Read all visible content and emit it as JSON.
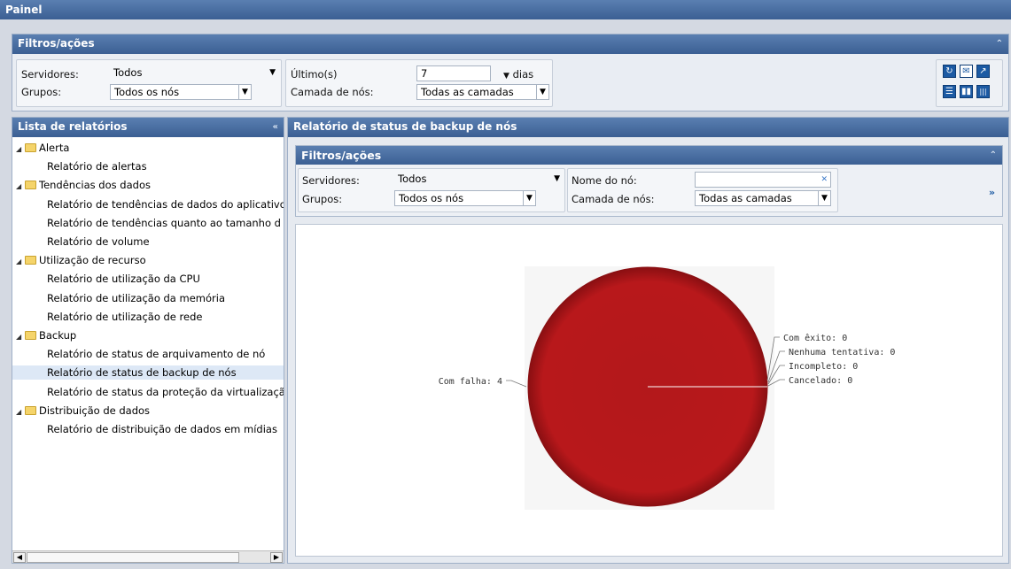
{
  "page": {
    "title": "Painel"
  },
  "top_filters": {
    "title": "Filtros/ações",
    "collapse_icon": "«",
    "servers_label": "Servidores:",
    "servers_value": "Todos",
    "groups_label": "Grupos:",
    "groups_value": "Todos os nós",
    "last_label": "Último(s)",
    "last_value": "7",
    "last_unit": "dias",
    "tier_label": "Camada de nós:",
    "tier_value": "Todas as camadas",
    "toolbar_icons": [
      "refresh-icon",
      "email-icon",
      "export-icon",
      "layout-single-icon",
      "layout-two-columns-icon",
      "layout-three-columns-icon"
    ]
  },
  "report_list": {
    "title": "Lista de relatórios",
    "collapse_icon": "«",
    "categories": [
      {
        "label": "Alerta",
        "items": [
          "Relatório de alertas"
        ]
      },
      {
        "label": "Tendências dos dados",
        "items": [
          "Relatório de tendências de dados do aplicativo",
          "Relatório de tendências quanto ao tamanho d",
          "Relatório de volume"
        ]
      },
      {
        "label": "Utilização de recurso",
        "items": [
          "Relatório de utilização da CPU",
          "Relatório de utilização da memória",
          "Relatório de utilização de rede"
        ]
      },
      {
        "label": "Backup",
        "items": [
          "Relatório de status de arquivamento de nó",
          "Relatório de status de backup de nós",
          "Relatório de status da proteção da virtualizaçã"
        ]
      },
      {
        "label": "Distribuição de dados",
        "items": [
          "Relatório de distribuição de dados em mídias"
        ]
      }
    ],
    "selected": "Relatório de status de backup de nós"
  },
  "report": {
    "title": "Relatório de status de backup de nós",
    "filters": {
      "title": "Filtros/ações",
      "servers_label": "Servidores:",
      "servers_value": "Todos",
      "groups_label": "Grupos:",
      "groups_value": "Todos os nós",
      "node_name_label": "Nome do nó:",
      "node_name_value": "",
      "tier_label": "Camada de nós:",
      "tier_value": "Todas as camadas",
      "more_icon": "»"
    }
  },
  "chart_data": {
    "type": "pie",
    "slices": [
      {
        "label": "Com falha",
        "value": 4,
        "display": "Com falha: 4"
      },
      {
        "label": "Com êxito",
        "value": 0,
        "display": "Com êxito: 0"
      },
      {
        "label": "Nenhuma tentativa",
        "value": 0,
        "display": "Nenhuma tentativa: 0"
      },
      {
        "label": "Incompleto",
        "value": 0,
        "display": "Incompleto: 0"
      },
      {
        "label": "Cancelado",
        "value": 0,
        "display": "Cancelado: 0"
      }
    ],
    "colors": {
      "Com falha": "#b8181b"
    }
  }
}
